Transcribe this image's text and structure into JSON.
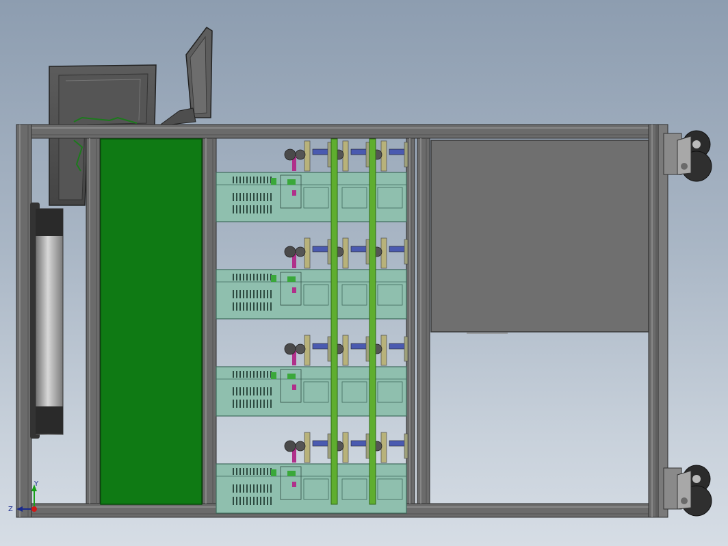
{
  "view": {
    "type": "cad-model-view",
    "background_gradient": [
      "#8d9db0",
      "#d6dde5"
    ]
  },
  "triad": {
    "x_label": "",
    "y_label": "Y",
    "z_label": "Z",
    "x_color": "#d01818",
    "y_color": "#18a018",
    "z_color": "#1a2a8c"
  },
  "colors": {
    "frame": "#6b6b6b",
    "frame_light": "#9a9a9a",
    "green_panel": "#0f7a14",
    "module": "#8fbfae",
    "gray_box": "#6f6f6f",
    "rail_green": "#5fae2f",
    "bolt_blue": "#4a5ab0",
    "pin_magenta": "#b0308a"
  },
  "assembly": {
    "module_rows": 4,
    "motor_columns": 3,
    "casters": 2
  }
}
